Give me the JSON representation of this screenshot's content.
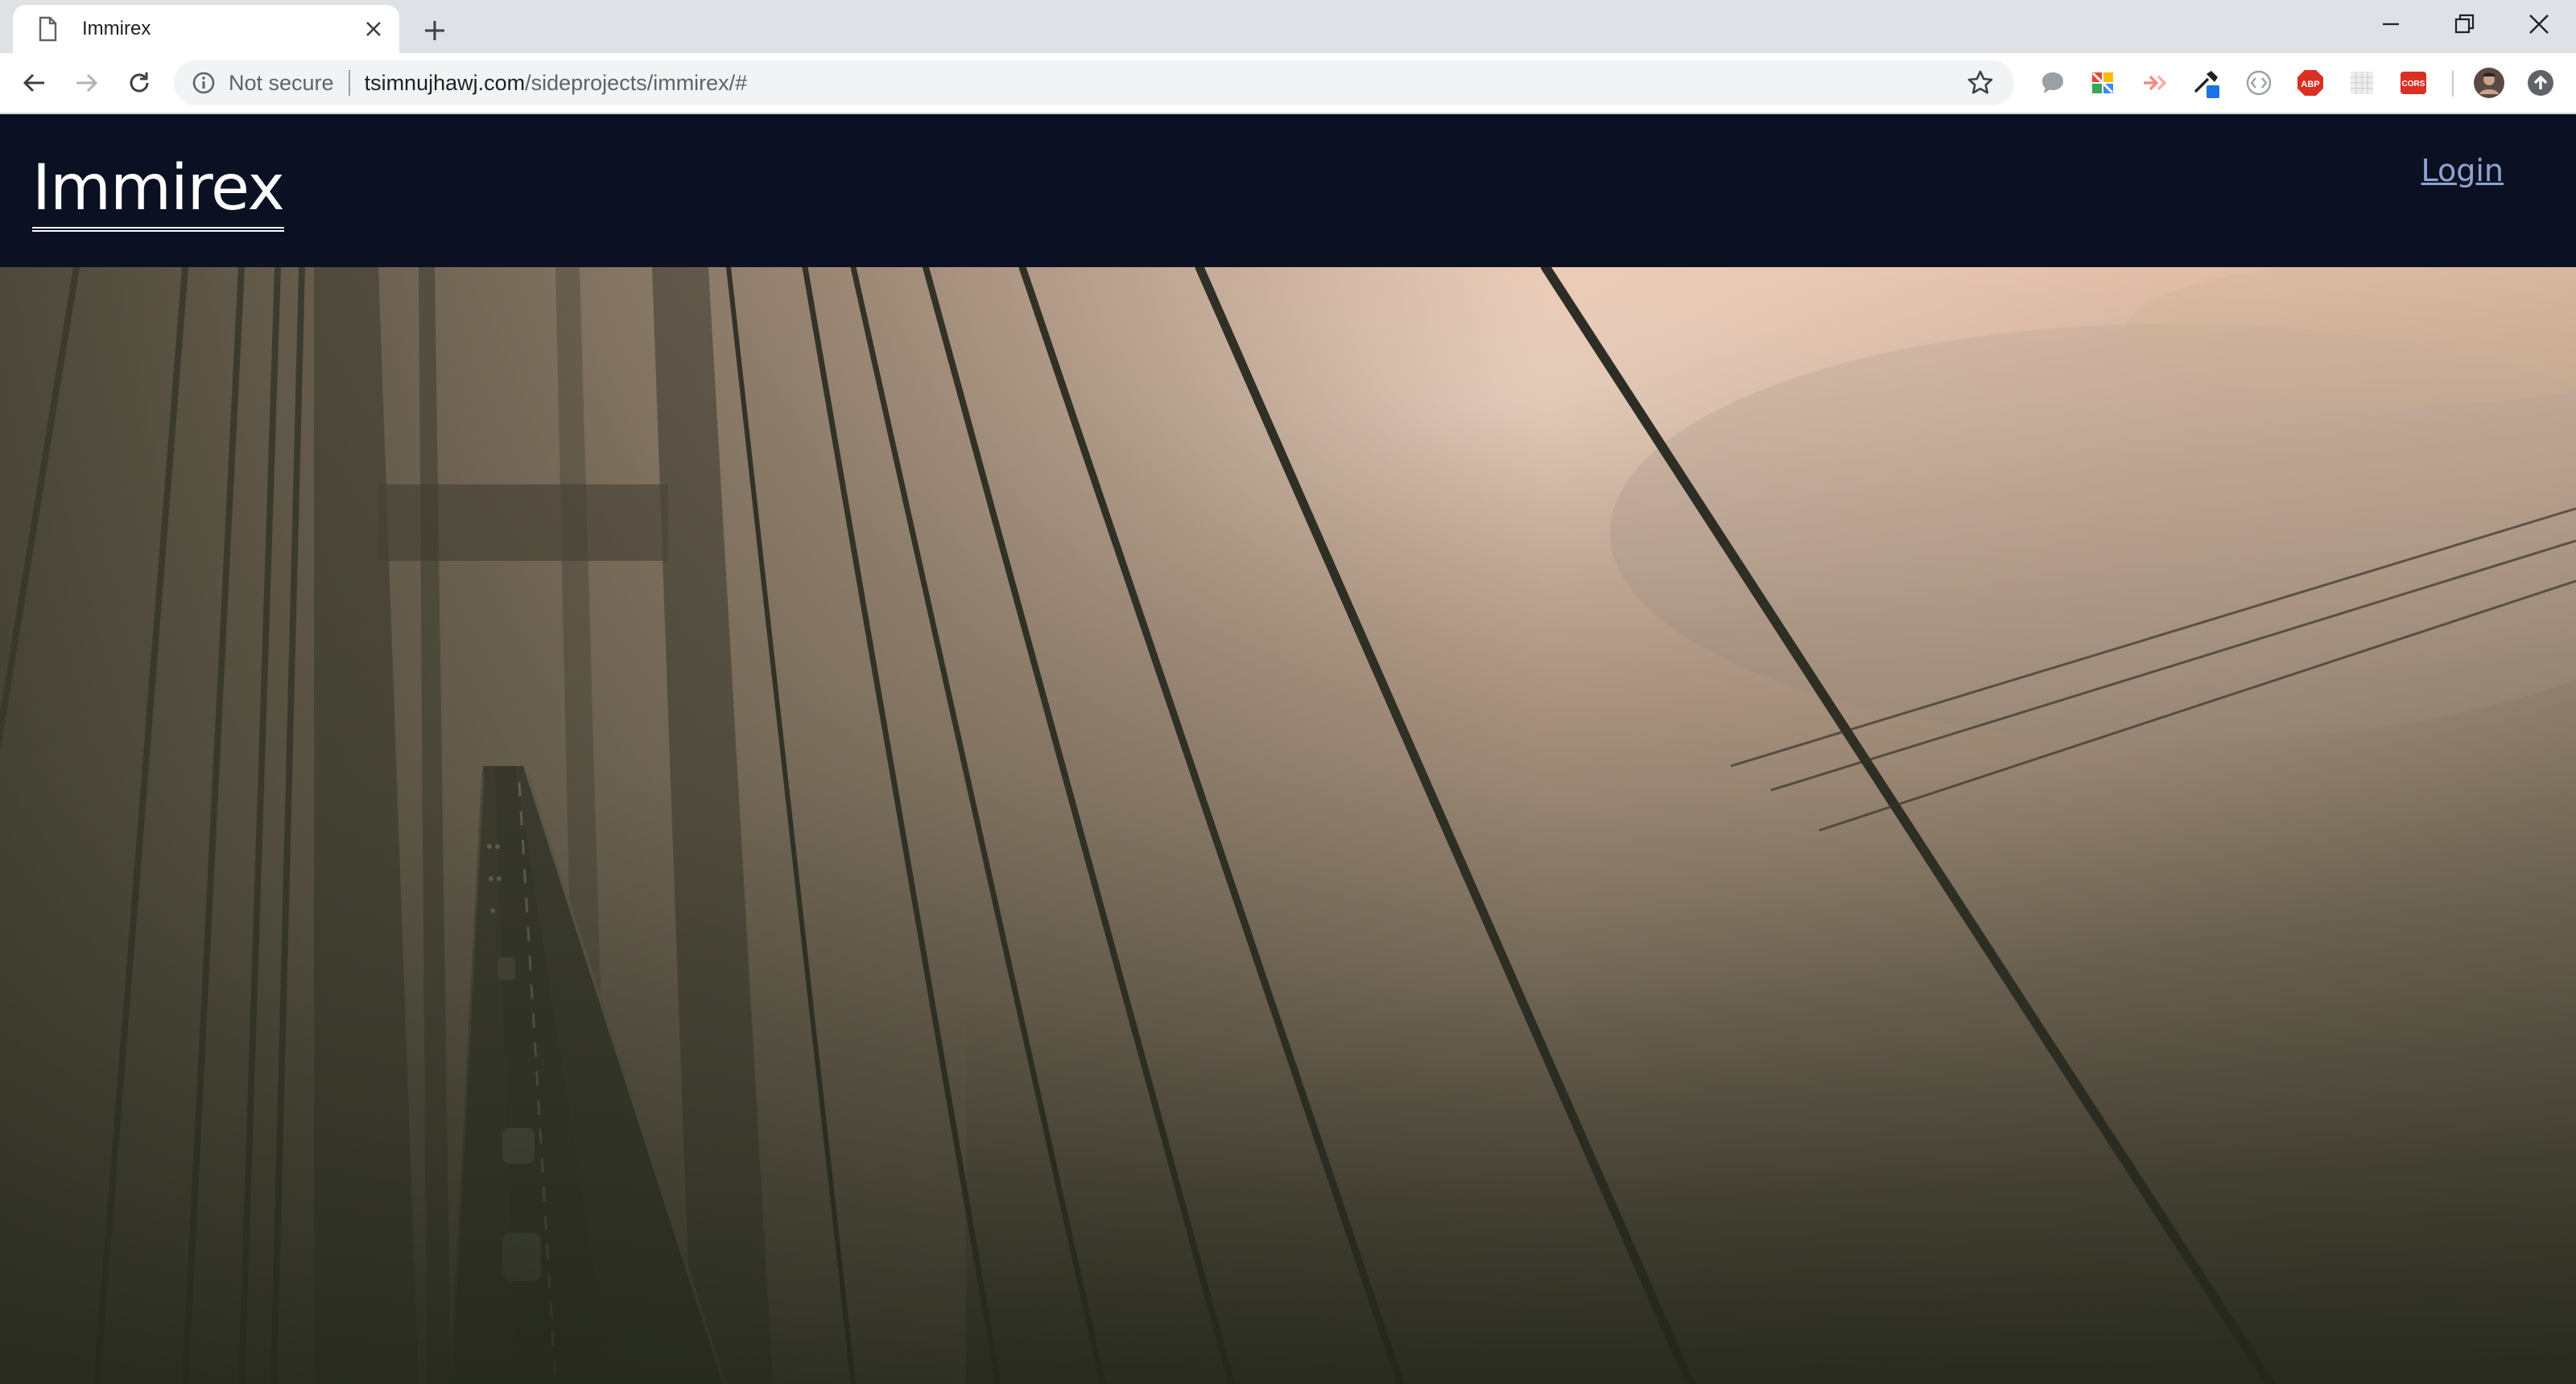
{
  "browser": {
    "tab": {
      "title": "Immirex",
      "favicon_icon": "page-icon",
      "close_icon": "close-icon"
    },
    "new_tab_icon": "plus-icon",
    "window_controls": [
      "minimize-icon",
      "restore-icon",
      "close-icon"
    ],
    "nav": [
      "back-arrow-icon",
      "forward-arrow-icon",
      "reload-icon"
    ],
    "address": {
      "security_label": "Not secure",
      "domain": "tsimnujhawj.com",
      "path": "/sideprojects/immirex/#"
    },
    "bookmark_icon": "star-icon",
    "extensions": [
      "speech-bubble-icon",
      "colored-squares-icon",
      "arrow-extension-icon",
      "eyedropper-icon",
      "code-brackets-icon",
      "abp-icon",
      "grid-icon",
      "cors-icon"
    ],
    "ext_labels": {
      "abp": "ABP",
      "cors": "CORS"
    },
    "profile_icon": "avatar-icon",
    "update_icon": "update-arrow-icon"
  },
  "site": {
    "brand": "Immirex",
    "login_label": "Login"
  },
  "hero": {
    "image_subject": "foggy cable-stayed bridge at sunrise",
    "colors": {
      "sky": "#e7c4ad",
      "fog": "#b49a84",
      "shadow": "#2e3124",
      "header": "#0b1123"
    }
  }
}
